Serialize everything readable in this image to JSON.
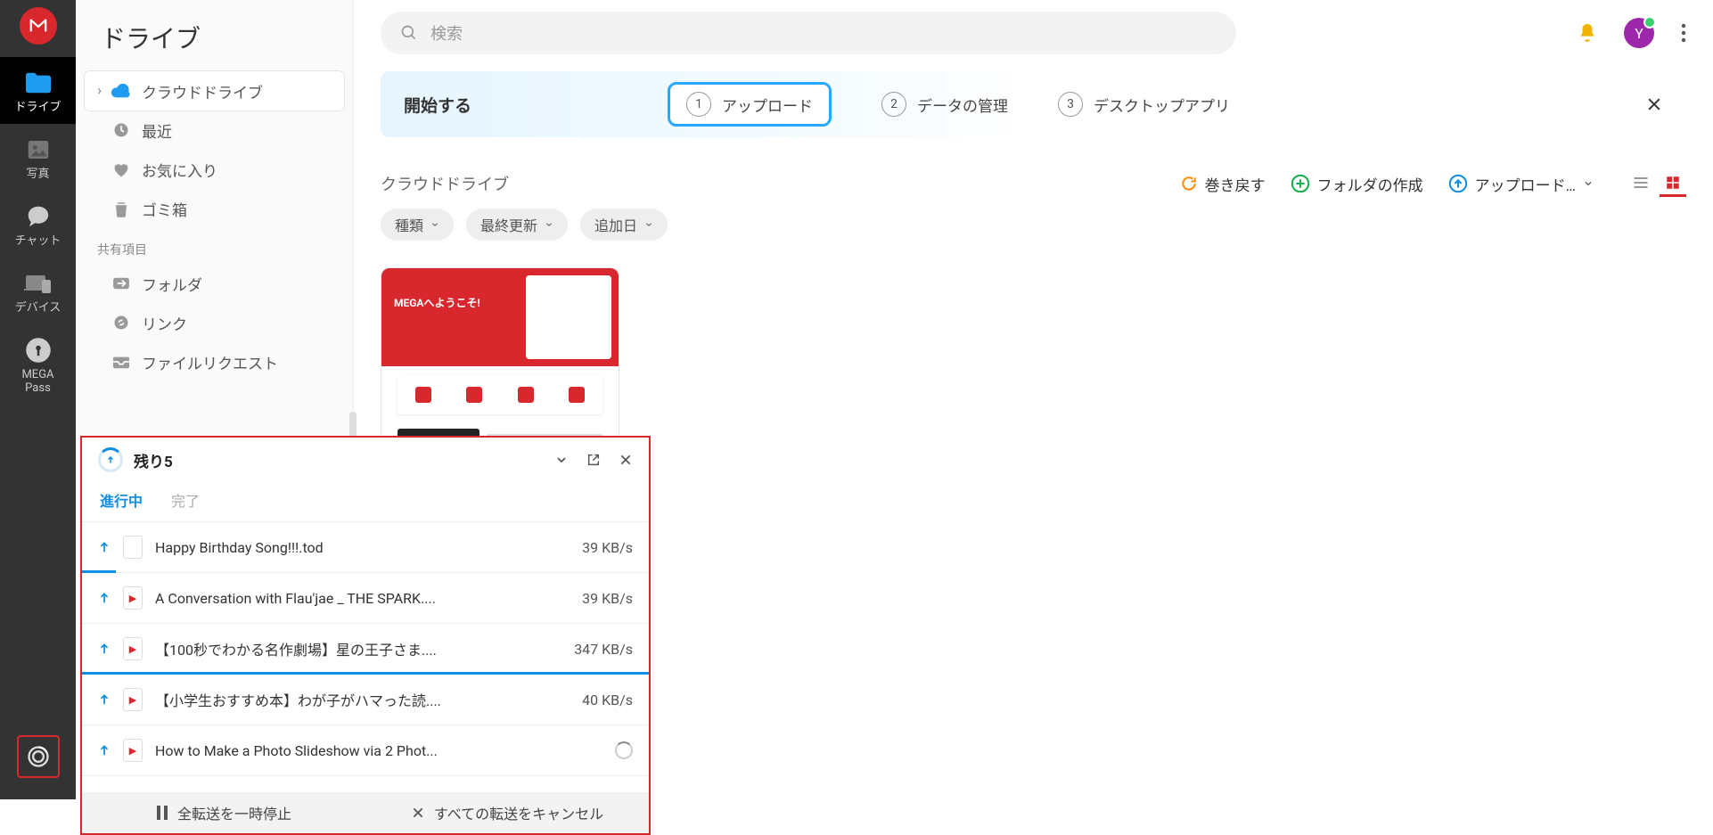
{
  "rail": {
    "items": [
      {
        "label": "ドライブ"
      },
      {
        "label": "写真"
      },
      {
        "label": "チャット"
      },
      {
        "label": "デバイス"
      },
      {
        "label": "MEGA\nPass"
      }
    ]
  },
  "tree": {
    "header": "ドライブ",
    "rows": [
      {
        "label": "クラウドドライブ"
      },
      {
        "label": "最近"
      },
      {
        "label": "お気に入り"
      },
      {
        "label": "ゴミ箱"
      }
    ],
    "shared_section": "共有項目",
    "shared": [
      {
        "label": "フォルダ"
      },
      {
        "label": "リンク"
      },
      {
        "label": "ファイルリクエスト"
      }
    ]
  },
  "search": {
    "placeholder": "検索"
  },
  "avatar_initial": "Y",
  "onboard": {
    "title": "開始する",
    "steps": [
      {
        "num": "1",
        "label": "アップロード"
      },
      {
        "num": "2",
        "label": "データの管理"
      },
      {
        "num": "3",
        "label": "デスクトップアプリ"
      }
    ]
  },
  "crumb": "クラウドドライブ",
  "actions": {
    "rewind": "巻き戻す",
    "new_folder": "フォルダの作成",
    "upload": "アップロード…"
  },
  "chips": [
    "種類",
    "最終更新",
    "追加日"
  ],
  "thumb_caption": "MEGAへようこそ!",
  "xfer": {
    "title": "残り5",
    "tabs": {
      "active": "進行中",
      "done": "完了"
    },
    "items": [
      {
        "name": "Happy Birthday Song!!!.tod",
        "rate": "39 KB/s",
        "type": "doc",
        "progress": 6
      },
      {
        "name": "A Conversation with Flau'jae _ THE SPARK....",
        "rate": "39 KB/s",
        "type": "vid",
        "progress": 0
      },
      {
        "name": "【100秒でわかる名作劇場】星の王子さま....",
        "rate": "347 KB/s",
        "type": "vid",
        "progress": 100
      },
      {
        "name": "【小学生おすすめ本】わが子がハマった読....",
        "rate": "40 KB/s",
        "type": "vid",
        "progress": 0
      },
      {
        "name": "How to Make a Photo Slideshow via 2 Phot...",
        "rate": "",
        "type": "vid",
        "loading": true,
        "progress": 0
      }
    ],
    "foot": {
      "pause": "全転送を一時停止",
      "cancel": "すべての転送をキャンセル"
    }
  }
}
